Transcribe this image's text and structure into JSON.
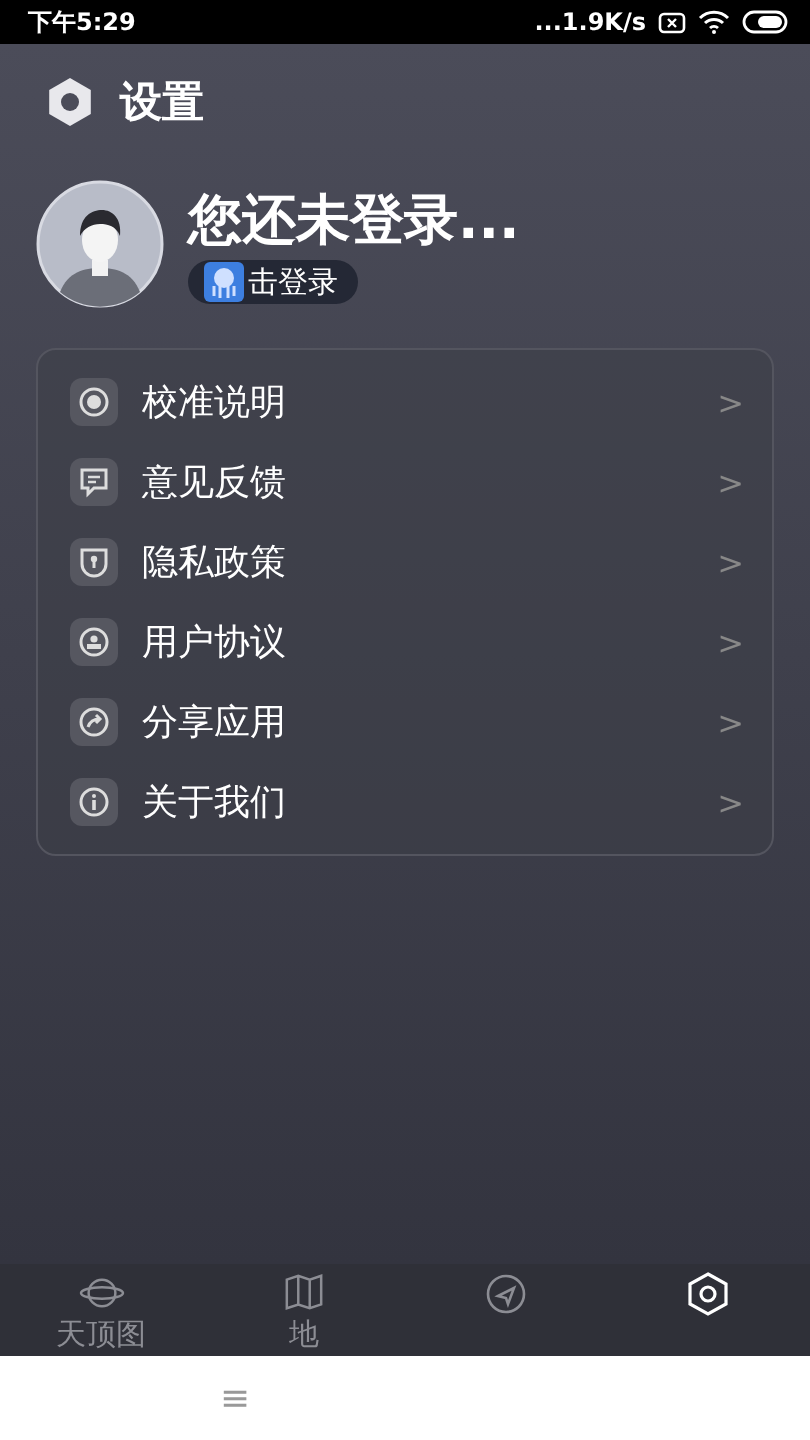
{
  "status_bar": {
    "time": "下午5:29",
    "speed": "...1.9K/s"
  },
  "header": {
    "title": "设置"
  },
  "profile": {
    "name": "您还未登录...",
    "login_button": "击登录"
  },
  "menu": [
    {
      "label": "校准说明",
      "kind": "target",
      "chevron": ">"
    },
    {
      "label": "意见反馈",
      "kind": "chat",
      "chevron": ">"
    },
    {
      "label": "隐私政策",
      "kind": "shield",
      "chevron": ">"
    },
    {
      "label": "用户协议",
      "kind": "user",
      "chevron": ">"
    },
    {
      "label": "分享应用",
      "kind": "share",
      "chevron": ">"
    },
    {
      "label": "关于我们",
      "kind": "info",
      "chevron": ">"
    }
  ],
  "tabs": [
    {
      "label": "天顶图",
      "kind": "planet",
      "selected": false
    },
    {
      "label": "地",
      "kind": "map",
      "selected": false
    },
    {
      "kind": "compass",
      "selected": false
    },
    {
      "kind": "hexagon",
      "selected": true
    }
  ],
  "nav_bar": {
    "menu": "≡"
  }
}
